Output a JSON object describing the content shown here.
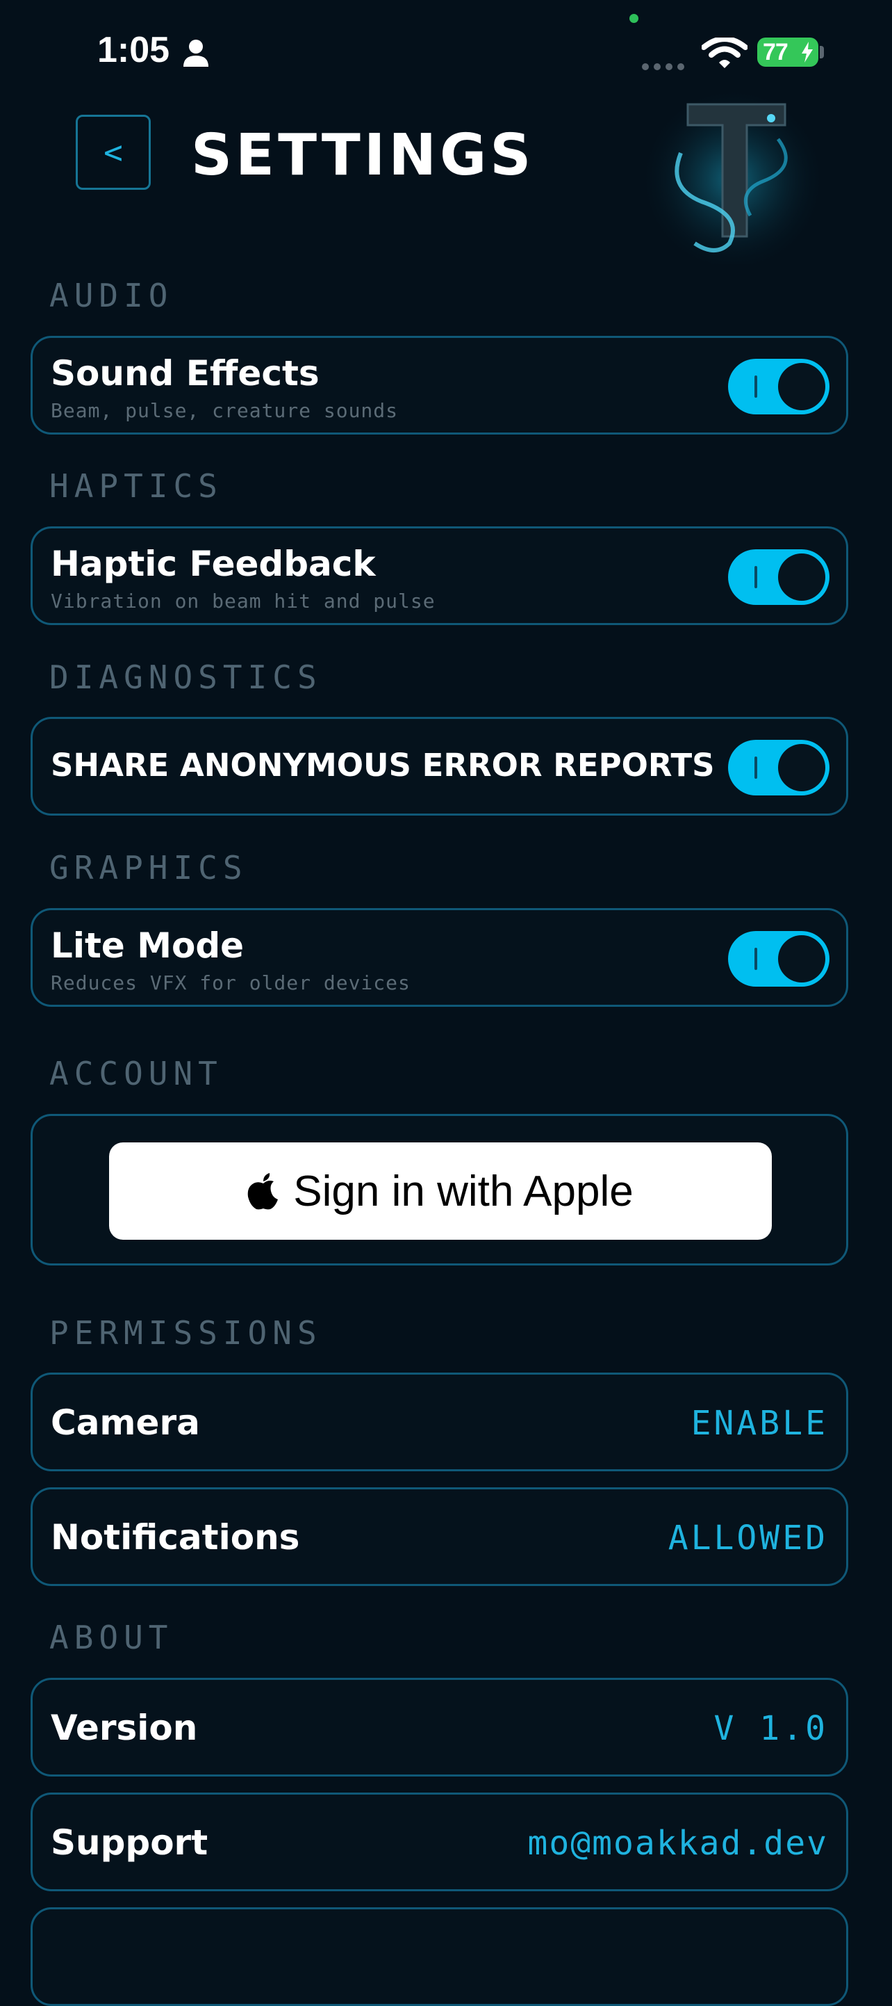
{
  "status_bar": {
    "time": "1:05",
    "battery": "77",
    "icons": [
      "person-icon",
      "signal-icon",
      "wifi-icon",
      "battery-charging-icon"
    ]
  },
  "header": {
    "back_label": "<",
    "title": "SETTINGS",
    "logo": "dragon-letter-t-logo"
  },
  "audio": {
    "section": "AUDIO",
    "sound_effects": {
      "title": "Sound Effects",
      "subtitle": "Beam, pulse, creature sounds",
      "on": true
    }
  },
  "haptics": {
    "section": "HAPTICS",
    "haptic_feedback": {
      "title": "Haptic Feedback",
      "subtitle": "Vibration on beam hit and pulse",
      "on": true
    }
  },
  "diagnostics": {
    "section": "DIAGNOSTICS",
    "error_reports": {
      "title": "SHARE ANONYMOUS ERROR REPORTS",
      "on": true
    }
  },
  "graphics": {
    "section": "GRAPHICS",
    "lite_mode": {
      "title": "Lite Mode",
      "subtitle": "Reduces VFX for older devices",
      "on": true
    }
  },
  "account": {
    "section": "ACCOUNT",
    "apple_button": "Sign in with Apple"
  },
  "permissions": {
    "section": "PERMISSIONS",
    "camera": {
      "title": "Camera",
      "value": "ENABLE"
    },
    "notifications": {
      "title": "Notifications",
      "value": "ALLOWED"
    }
  },
  "about": {
    "section": "ABOUT",
    "version": {
      "title": "Version",
      "value": "V 1.0"
    },
    "support": {
      "title": "Support",
      "value": "mo@moakkad.dev"
    }
  },
  "colors": {
    "background": "#04101a",
    "accent": "#00bff0",
    "card_border": "#0f5877",
    "section_label": "#4f6472",
    "battery": "#34c759"
  }
}
